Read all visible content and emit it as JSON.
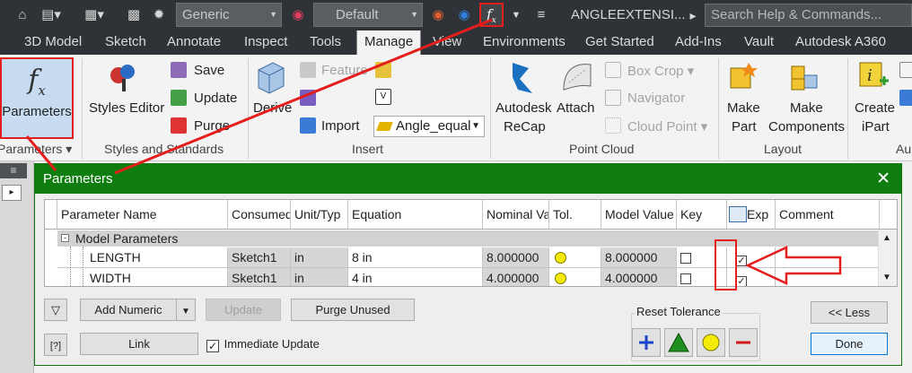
{
  "quick_access": {
    "appearance_value": "Generic",
    "visual_style_value": "Default",
    "parameters_button": "f",
    "document_title": "ANGLEEXTENSI...",
    "search_placeholder": "Search Help & Commands..."
  },
  "tabs": [
    "3D Model",
    "Sketch",
    "Annotate",
    "Inspect",
    "Tools",
    "Manage",
    "View",
    "Environments",
    "Get Started",
    "Add-Ins",
    "Vault",
    "Autodesk A360"
  ],
  "active_tab": "Manage",
  "ribbon": {
    "parameters_panel": {
      "button_label": "Parameters",
      "panel_label": "Parameters"
    },
    "styles_panel": {
      "styles_editor": "Styles Editor",
      "save": "Save",
      "update": "Update",
      "purge": "Purge",
      "panel_label": "Styles and Standards"
    },
    "insert_panel": {
      "derive": "Derive",
      "feature": "Feature",
      "import": "Import",
      "angle_value": "Angle_equal",
      "panel_label": "Insert"
    },
    "pointcloud_panel": {
      "recap_line1": "Autodesk",
      "recap_line2": "ReCap",
      "attach": "Attach",
      "box_crop": "Box Crop",
      "navigator": "Navigator",
      "cloud_point": "Cloud Point",
      "panel_label": "Point Cloud"
    },
    "layout_panel": {
      "make_part_line1": "Make",
      "make_part_line2": "Part",
      "make_comp_line1": "Make",
      "make_comp_line2": "Components",
      "panel_label": "Layout"
    },
    "author_panel": {
      "create_line1": "Create",
      "create_line2": "iPart",
      "panel_label": "Au"
    }
  },
  "dialog": {
    "title": "Parameters",
    "columns": [
      "Parameter Name",
      "Consumed",
      "Unit/Typ",
      "Equation",
      "Nominal Va",
      "Tol.",
      "Model Value",
      "Key",
      "Exp",
      "Comment"
    ],
    "group_label": "Model Parameters",
    "rows": [
      {
        "name": "LENGTH",
        "consumed": "Sketch1",
        "unit": "in",
        "equation": "8 in",
        "nominal": "8.000000",
        "model": "8.000000",
        "key": false,
        "export": true
      },
      {
        "name": "WIDTH",
        "consumed": "Sketch1",
        "unit": "in",
        "equation": "4 in",
        "nominal": "4.000000",
        "model": "4.000000",
        "key": false,
        "export": true
      }
    ],
    "buttons": {
      "add_numeric": "Add Numeric",
      "update": "Update",
      "purge_unused": "Purge Unused",
      "link": "Link",
      "immediate_update": "Immediate Update",
      "less": "<< Less",
      "done": "Done"
    },
    "immediate_update_checked": true,
    "reset_tolerance": "Reset Tolerance"
  },
  "colors": {
    "dialog_title_bg": "#0f7d0f",
    "annotation_red": "#e41d1d",
    "tolerance_yellow": "#f5ea0a",
    "ribbon_dark": "#2f3337"
  }
}
